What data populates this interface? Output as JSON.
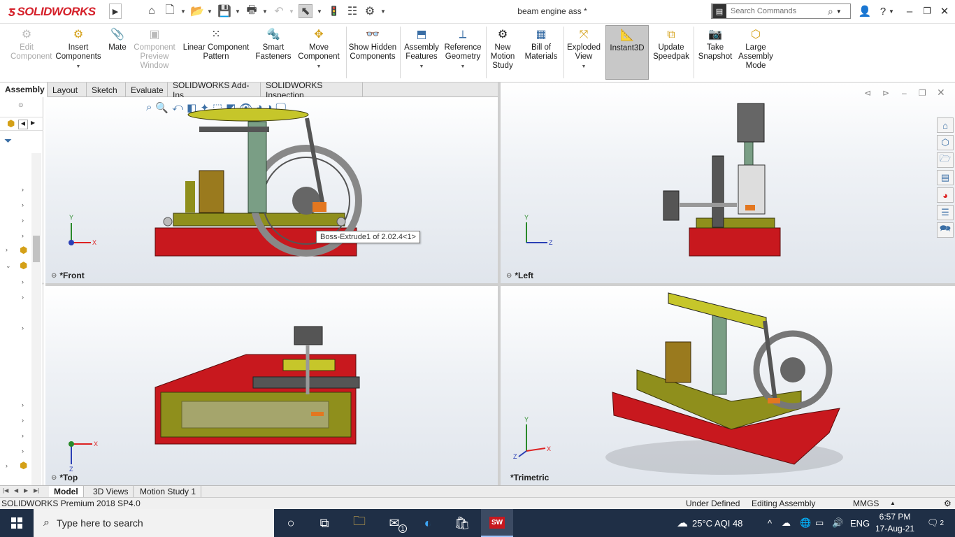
{
  "app": {
    "title": "beam engine ass *",
    "logo_text": "SOLIDWORKS"
  },
  "search": {
    "placeholder": "Search Commands"
  },
  "toolbar": {
    "items": [
      {
        "label": "Edit Component",
        "enabled": false
      },
      {
        "label": "Insert Components",
        "enabled": true
      },
      {
        "label": "Mate",
        "enabled": true
      },
      {
        "label": "Component Preview Window",
        "enabled": false
      },
      {
        "label": "Linear Component Pattern",
        "enabled": true
      },
      {
        "label": "Smart Fasteners",
        "enabled": true
      },
      {
        "label": "Move Component",
        "enabled": true
      },
      {
        "label": "Show Hidden Components",
        "enabled": true
      },
      {
        "label": "Assembly Features",
        "enabled": true
      },
      {
        "label": "Reference Geometry",
        "enabled": true
      },
      {
        "label": "New Motion Study",
        "enabled": true
      },
      {
        "label": "Bill of Materials",
        "enabled": true
      },
      {
        "label": "Exploded View",
        "enabled": true
      },
      {
        "label": "Instant3D",
        "enabled": true,
        "active": true
      },
      {
        "label": "Update Speedpak",
        "enabled": true
      },
      {
        "label": "Take Snapshot",
        "enabled": true
      },
      {
        "label": "Large Assembly Mode",
        "enabled": true
      }
    ]
  },
  "command_tabs": [
    "Assembly",
    "Layout",
    "Sketch",
    "Evaluate",
    "SOLIDWORKS Add-Ins",
    "SOLIDWORKS Inspection"
  ],
  "viewports": {
    "front": {
      "label": "*Front",
      "axis_up": "Y",
      "axis_right": "X"
    },
    "left": {
      "label": "*Left",
      "axis_up": "Y",
      "axis_right": "Z"
    },
    "top": {
      "label": "*Top",
      "axis_down": "Z",
      "axis_right": "X"
    },
    "trimetric": {
      "label": "*Trimetric",
      "axis_up": "Y",
      "axis_right": "X",
      "axis_left": "Z"
    }
  },
  "tooltip": "Boss-Extrude1 of 2.02.4<1>",
  "bottom_tabs": [
    "Model",
    "3D Views",
    "Motion Study 1"
  ],
  "status": {
    "product": "SOLIDWORKS Premium 2018 SP4.0",
    "state": "Under Defined",
    "mode": "Editing Assembly",
    "units": "MMGS"
  },
  "taskbar": {
    "search_placeholder": "Type here to search",
    "weather": "25°C  AQI 48",
    "language": "ENG",
    "time": "6:57 PM",
    "date": "17-Aug-21",
    "notifications": "2",
    "mail_badge": "1"
  },
  "colors": {
    "base": "#c8181e",
    "plate": "#8f8f1c",
    "column": "#7a9e85",
    "brand": "#d5202a",
    "taskbar": "#1f2f46"
  }
}
